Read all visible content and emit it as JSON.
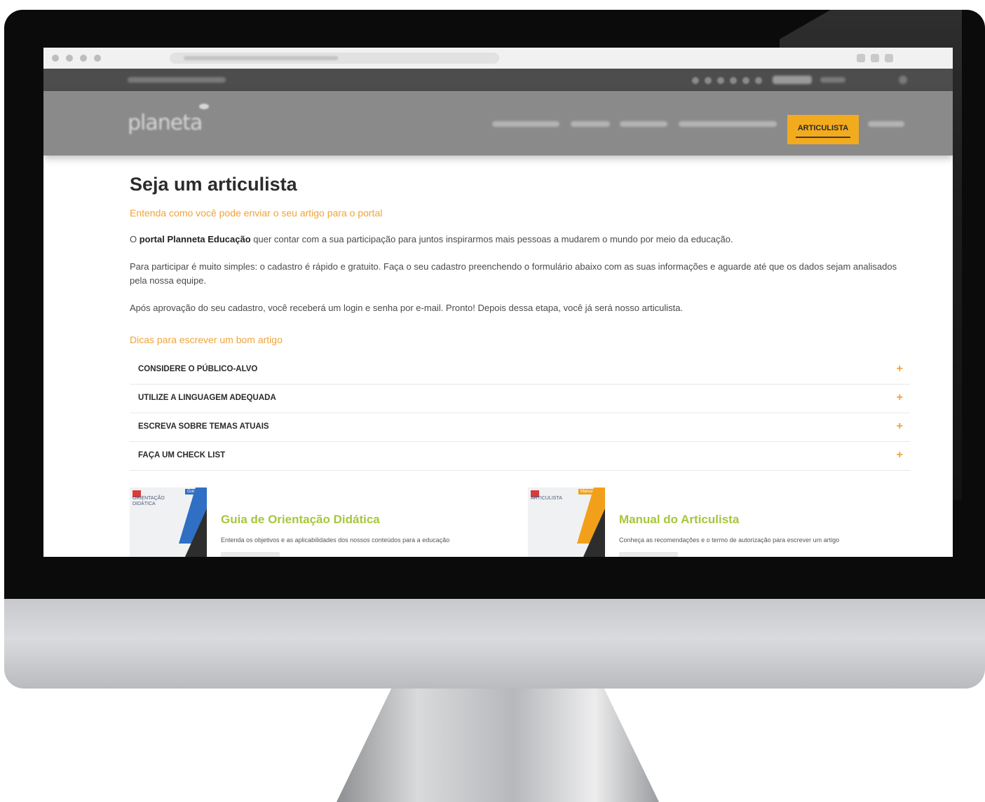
{
  "header": {
    "active_nav_label": "ARTICULISTA"
  },
  "page": {
    "title": "Seja um articulista",
    "subtitle": "Entenda como você pode enviar o seu artigo para o portal",
    "intro_prefix": "O ",
    "intro_bold": "portal Planneta Educação",
    "intro_rest": " quer contar com a sua participação para juntos inspirarmos mais pessoas a mudarem o mundo por meio da educação.",
    "paragraph_2": "Para participar é muito simples: o cadastro é rápido e gratuito. Faça o seu cadastro preenchendo o formulário abaixo com as suas informações e aguarde até que os dados sejam analisados pela nossa equipe.",
    "paragraph_3": "Após aprovação do seu cadastro, você receberá um login e senha por e-mail. Pronto! Depois dessa etapa, você já será nosso articulista.",
    "tips_heading": "Dicas para escrever um bom artigo"
  },
  "accordion": {
    "expand_symbol": "+",
    "items": [
      {
        "label": "CONSIDERE O PÚBLICO-ALVO"
      },
      {
        "label": "UTILIZE A LINGUAGEM ADEQUADA"
      },
      {
        "label": "ESCREVA SOBRE TEMAS ATUAIS"
      },
      {
        "label": "FAÇA UM CHECK LIST"
      }
    ]
  },
  "cards": [
    {
      "title": "Guia de Orientação Didática",
      "description": "Entenda os objetivos e as aplicabilidades dos nossos conteúdos para a educação",
      "cover_tag": "Guia de",
      "cover_title": "ORIENTAÇÃO DIDÁTICA",
      "accent": "#2f6fc4"
    },
    {
      "title": "Manual do Articulista",
      "description": "Conheça as recomendações e o termo de autorização para escrever um artigo",
      "cover_tag": "Manual do",
      "cover_title": "ARTICULISTA",
      "accent": "#f2a01a"
    }
  ],
  "colors": {
    "orange": "#f0a33a",
    "nav_active": "#f2ab1d",
    "card_title_green": "#a7c63a",
    "header_gray": "#8a8a8a",
    "topbar_gray": "#4d4d4d"
  }
}
